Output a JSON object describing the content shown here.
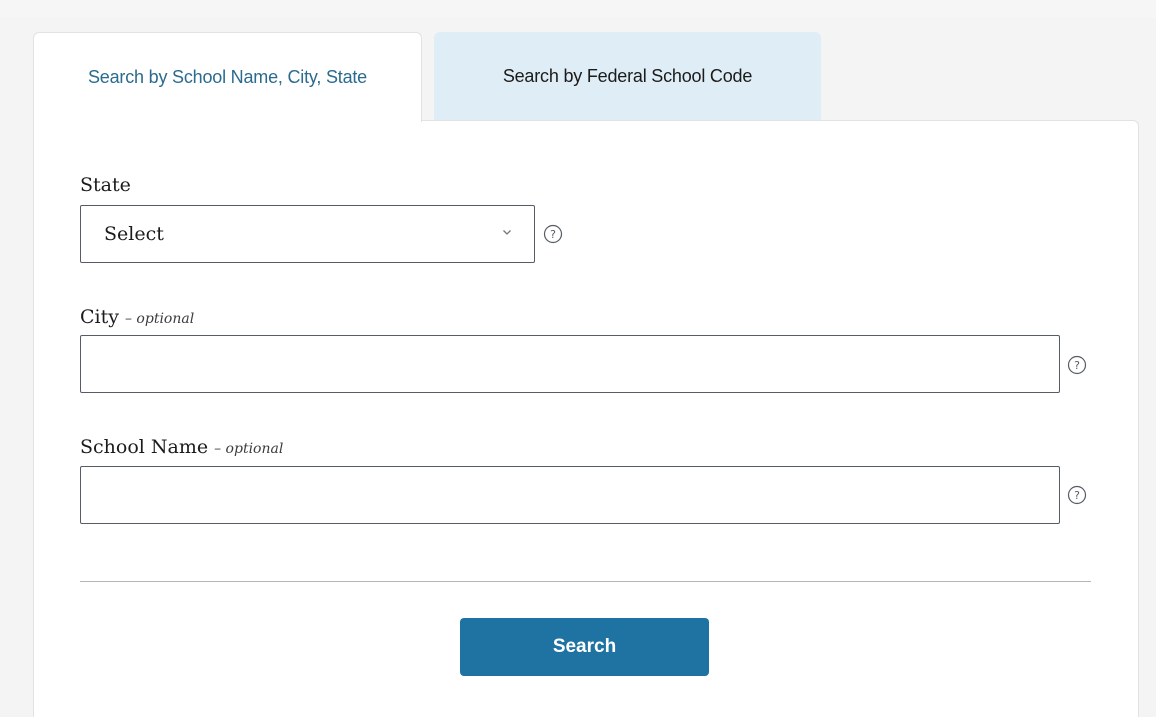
{
  "tabs": [
    {
      "label": "Search by School Name, City, State",
      "active": true
    },
    {
      "label": "Search by Federal School Code",
      "active": false
    }
  ],
  "form": {
    "state": {
      "label": "State",
      "selected": "Select"
    },
    "city": {
      "label": "City",
      "optional": "– optional",
      "value": ""
    },
    "school_name": {
      "label": "School Name",
      "optional": "– optional",
      "value": ""
    },
    "search_label": "Search"
  },
  "icons": {
    "help": "question-circle-icon",
    "dropdown": "chevron-down-icon"
  },
  "colors": {
    "active_tab_text": "#2a6b8f",
    "inactive_tab_bg": "#dfeef6",
    "button_bg": "#1f73a3"
  }
}
